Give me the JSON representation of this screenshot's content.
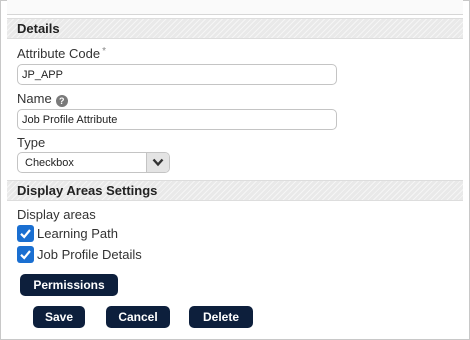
{
  "details": {
    "title": "Details",
    "attribute_code": {
      "label": "Attribute Code",
      "required_mark": "*",
      "value": "JP_APP"
    },
    "name": {
      "label": "Name",
      "help_icon": "question-circle-icon",
      "value": "Job Profile Attribute"
    },
    "type": {
      "label": "Type",
      "selected": "Checkbox"
    }
  },
  "display_areas": {
    "title": "Display Areas Settings",
    "label": "Display areas",
    "options": [
      {
        "label": "Learning Path",
        "checked": true
      },
      {
        "label": "Job Profile Details",
        "checked": true
      }
    ]
  },
  "buttons": {
    "permissions": "Permissions",
    "save": "Save",
    "cancel": "Cancel",
    "delete": "Delete"
  },
  "colors": {
    "button_bg": "#0d1f3c",
    "checkbox_bg": "#1a6fd1",
    "section_header_bg": "#e9e9e9"
  }
}
